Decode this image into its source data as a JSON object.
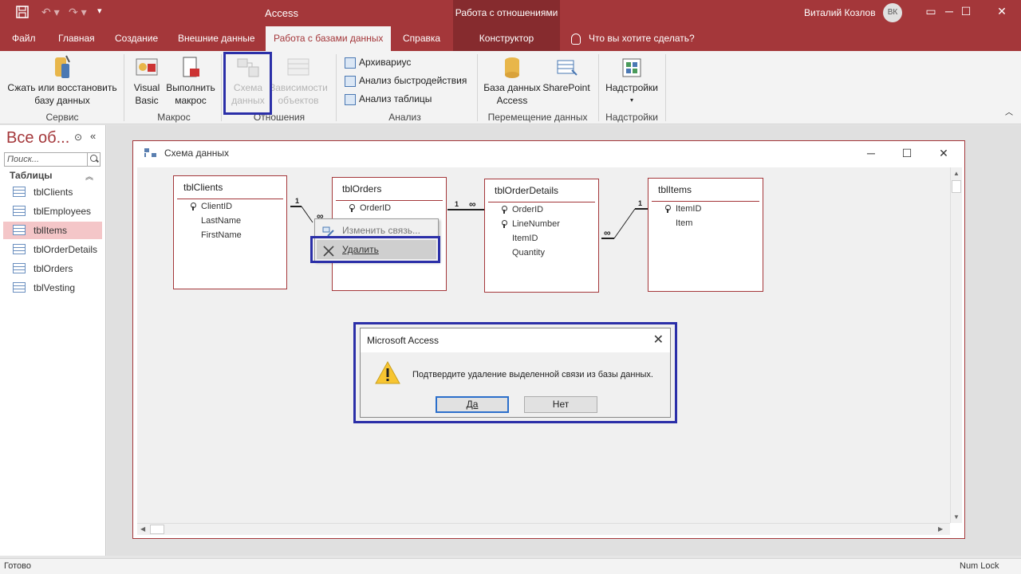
{
  "app": {
    "title": "Access",
    "context_group": "Работа с отношениями",
    "user_name": "Виталий Козлов",
    "user_initials": "ВК"
  },
  "tabs": [
    {
      "label": "Файл"
    },
    {
      "label": "Главная"
    },
    {
      "label": "Создание"
    },
    {
      "label": "Внешние данные"
    },
    {
      "label": "Работа с базами данных"
    },
    {
      "label": "Справка"
    },
    {
      "label": "Конструктор"
    }
  ],
  "tell_me": "Что вы хотите сделать?",
  "ribbon": {
    "compact": "Сжать или восстановить базу данных",
    "compact_l1": "Сжать или восстановить",
    "compact_l2": "базу данных",
    "group_service": "Сервис",
    "vb_l1": "Visual",
    "vb_l2": "Basic",
    "run_l1": "Выполнить",
    "run_l2": "макрос",
    "group_macro": "Макрос",
    "schema_l1": "Схема",
    "schema_l2": "данных",
    "deps_l1": "Зависимости",
    "deps_l2": "объектов",
    "group_relations": "Отношения",
    "archivist": "Архивариус",
    "perf": "Анализ быстродействия",
    "table_analysis": "Анализ таблицы",
    "group_analysis": "Анализ",
    "db_l1": "База данных",
    "db_l2": "Access",
    "sharepoint": "SharePoint",
    "group_move": "Перемещение данных",
    "addins": "Надстройки",
    "group_addins": "Надстройки",
    "accent": "#a4373a"
  },
  "nav": {
    "title": "Все об...",
    "search_placeholder": "Поиск...",
    "section": "Таблицы",
    "items": [
      {
        "label": "tblClients"
      },
      {
        "label": "tblEmployees"
      },
      {
        "label": "tblItems"
      },
      {
        "label": "tblOrderDetails"
      },
      {
        "label": "tblOrders"
      },
      {
        "label": "tblVesting"
      }
    ],
    "selected": "tblItems"
  },
  "schema_window": {
    "title": "Схема данных",
    "tables": [
      {
        "name": "tblClients",
        "fields": [
          {
            "name": "ClientID",
            "key": true
          },
          {
            "name": "LastName"
          },
          {
            "name": "FirstName"
          }
        ]
      },
      {
        "name": "tblOrders",
        "fields": [
          {
            "name": "OrderID",
            "key": true
          }
        ]
      },
      {
        "name": "tblOrderDetails",
        "fields": [
          {
            "name": "OrderID",
            "key": true
          },
          {
            "name": "LineNumber",
            "key": true
          },
          {
            "name": "ItemID"
          },
          {
            "name": "Quantity"
          }
        ]
      },
      {
        "name": "tblItems",
        "fields": [
          {
            "name": "ItemID",
            "key": true
          },
          {
            "name": "Item"
          }
        ]
      }
    ],
    "rel_one": "1",
    "rel_many": "∞"
  },
  "context_menu": {
    "edit": "Изменить связь...",
    "delete": "Удалить"
  },
  "dialog": {
    "title": "Microsoft Access",
    "message": "Подтвердите удаление выделенной связи из базы данных.",
    "yes": "Да",
    "no": "Нет"
  },
  "status": {
    "left": "Готово",
    "right": "Num Lock"
  }
}
